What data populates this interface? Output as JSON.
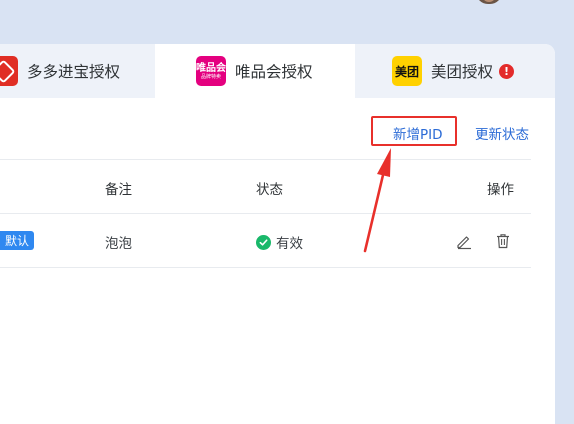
{
  "tabs": [
    {
      "label": "多多进宝授权",
      "logo": "pinduoduo-logo"
    },
    {
      "label": "唯品会授权",
      "logo": "vipshop-logo",
      "logo_text": "唯品会",
      "logo_subtext": "品牌特卖"
    },
    {
      "label": "美团授权",
      "logo": "meituan-logo",
      "logo_text": "美团",
      "alert": "!"
    }
  ],
  "actions": {
    "add_pid": "新增PID",
    "refresh_status": "更新状态"
  },
  "table": {
    "headers": {
      "remark": "备注",
      "status": "状态",
      "operation": "操作"
    },
    "rows": [
      {
        "badge": "默认",
        "remark": "泡泡",
        "status": "有效"
      }
    ]
  },
  "colors": {
    "accent": "#2b6bd6",
    "highlight_red": "#e8302b",
    "badge_blue": "#2f88f0",
    "status_green": "#19b86a",
    "pinduoduo_red": "#e02e24",
    "vipshop_pink": "#e4007f",
    "meituan_yellow": "#ffd100"
  },
  "icons": {
    "edit": "pencil-icon",
    "delete": "trash-icon",
    "status": "check-circle-icon",
    "alert": "exclamation-icon"
  }
}
